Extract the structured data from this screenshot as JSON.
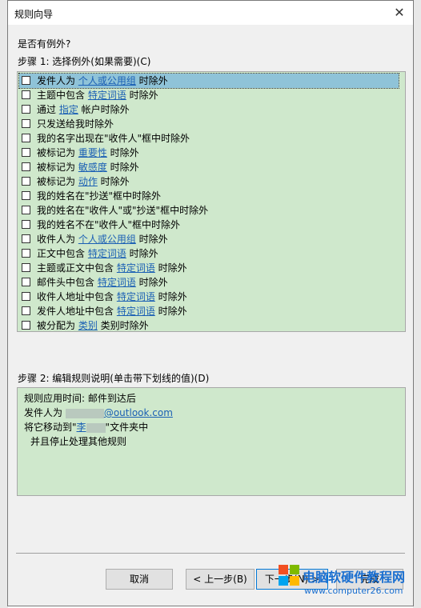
{
  "window": {
    "title": "规则向导",
    "close": "✕"
  },
  "question": "是否有例外?",
  "step1_label": "步骤 1: 选择例外(如果需要)(C)",
  "step2_label": "步骤 2: 编辑规则说明(单击带下划线的值)(D)",
  "exceptions": [
    {
      "pre": "发件人为 ",
      "link": "个人或公用组",
      "post": " 时除外",
      "checked": false,
      "selected": true
    },
    {
      "pre": "主题中包含 ",
      "link": "特定词语",
      "post": " 时除外",
      "checked": false
    },
    {
      "pre": "通过 ",
      "link": "指定",
      "post": " 帐户时除外",
      "checked": false
    },
    {
      "pre": "只发送给我时除外",
      "link": "",
      "post": "",
      "checked": false
    },
    {
      "pre": "我的名字出现在\"收件人\"框中时除外",
      "link": "",
      "post": "",
      "checked": false
    },
    {
      "pre": "被标记为 ",
      "link": "重要性",
      "post": " 时除外",
      "checked": false
    },
    {
      "pre": "被标记为 ",
      "link": "敏感度",
      "post": " 时除外",
      "checked": false
    },
    {
      "pre": "被标记为 ",
      "link": "动作",
      "post": " 时除外",
      "checked": false
    },
    {
      "pre": "我的姓名在\"抄送\"框中时除外",
      "link": "",
      "post": "",
      "checked": false
    },
    {
      "pre": "我的姓名在\"收件人\"或\"抄送\"框中时除外",
      "link": "",
      "post": "",
      "checked": false
    },
    {
      "pre": "我的姓名不在\"收件人\"框中时除外",
      "link": "",
      "post": "",
      "checked": false
    },
    {
      "pre": "收件人为 ",
      "link": "个人或公用组",
      "post": " 时除外",
      "checked": false
    },
    {
      "pre": "正文中包含 ",
      "link": "特定词语",
      "post": " 时除外",
      "checked": false
    },
    {
      "pre": "主题或正文中包含 ",
      "link": "特定词语",
      "post": " 时除外",
      "checked": false
    },
    {
      "pre": "邮件头中包含 ",
      "link": "特定词语",
      "post": " 时除外",
      "checked": false
    },
    {
      "pre": "收件人地址中包含 ",
      "link": "特定词语",
      "post": " 时除外",
      "checked": false
    },
    {
      "pre": "发件人地址中包含 ",
      "link": "特定词语",
      "post": " 时除外",
      "checked": false
    },
    {
      "pre": "被分配为 ",
      "link": "类别",
      "post": " 类别时除外",
      "checked": false
    }
  ],
  "description": {
    "line1": "规则应用时间: 邮件到达后",
    "line2_pre": "发件人为 ",
    "line2_link": "@outlook.com",
    "line3_pre": "将它移动到\"",
    "line3_link": "李",
    "line3_post": "\"文件夹中",
    "line4": "并且停止处理其他规则"
  },
  "buttons": {
    "cancel": "取消",
    "back": "< 上一步(B)",
    "next": "下一步(N) >",
    "finish": "完成"
  },
  "watermark": {
    "line1": "电脑软硬件教程网",
    "line2": "www.computer26.com"
  }
}
